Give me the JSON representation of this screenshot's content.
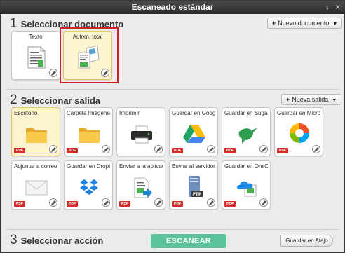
{
  "window": {
    "title": "Escaneado estándar",
    "back_glyph": "‹",
    "close_glyph": "×"
  },
  "section1": {
    "number": "1",
    "title": "Seleccionar documento",
    "add_button": "Nuevo documento",
    "add_icon": "plus-icon",
    "cards": [
      {
        "label": "Texto",
        "icon": "text-document-icon",
        "selected": false
      },
      {
        "label": "Autom. total",
        "icon": "auto-document-icon",
        "selected": true
      }
    ]
  },
  "section2": {
    "number": "2",
    "title": "Seleccionar salida",
    "add_button": "Nueva salida",
    "cards": [
      {
        "label": "Escritorio",
        "icon": "folder-icon",
        "badge": "PDF",
        "selected": true
      },
      {
        "label": "Carpeta Imágenes",
        "icon": "folder-icon",
        "badge": "PDF",
        "selected": false
      },
      {
        "label": "Imprimir",
        "icon": "printer-icon",
        "badge": "",
        "selected": false
      },
      {
        "label": "Guardar en Googl...",
        "icon": "google-drive-icon",
        "badge": "PDF",
        "selected": false
      },
      {
        "label": "Guardar en SugarS...",
        "icon": "sugarsync-icon",
        "badge": "PDF",
        "selected": false
      },
      {
        "label": "Guardar en Micros...",
        "icon": "microsoft-icon",
        "badge": "PDF",
        "selected": false
      },
      {
        "label": "Adjuntar a correo ...",
        "icon": "mail-icon",
        "badge": "PDF",
        "selected": false
      },
      {
        "label": "Guardar en Dropb...",
        "icon": "dropbox-icon",
        "badge": "PDF",
        "selected": false
      },
      {
        "label": "Enviar a la aplicación",
        "icon": "send-app-icon",
        "badge": "PDF",
        "selected": false
      },
      {
        "label": "Enviar al servidor F...",
        "icon": "ftp-server-icon",
        "badge": "PDF",
        "selected": false
      },
      {
        "label": "Guardar en OneDr...",
        "icon": "onedrive-icon",
        "badge": "PDF",
        "selected": false
      }
    ]
  },
  "section3": {
    "number": "3",
    "title": "Seleccionar acción",
    "scan_button": "ESCANEAR",
    "save_shortcut_button": "Guardar en Atajo"
  },
  "colors": {
    "accent": "#5cc49a",
    "selected_bg": "#fdf4d0",
    "highlight": "#d41f1f",
    "pdf_badge": "#d62b2b"
  }
}
